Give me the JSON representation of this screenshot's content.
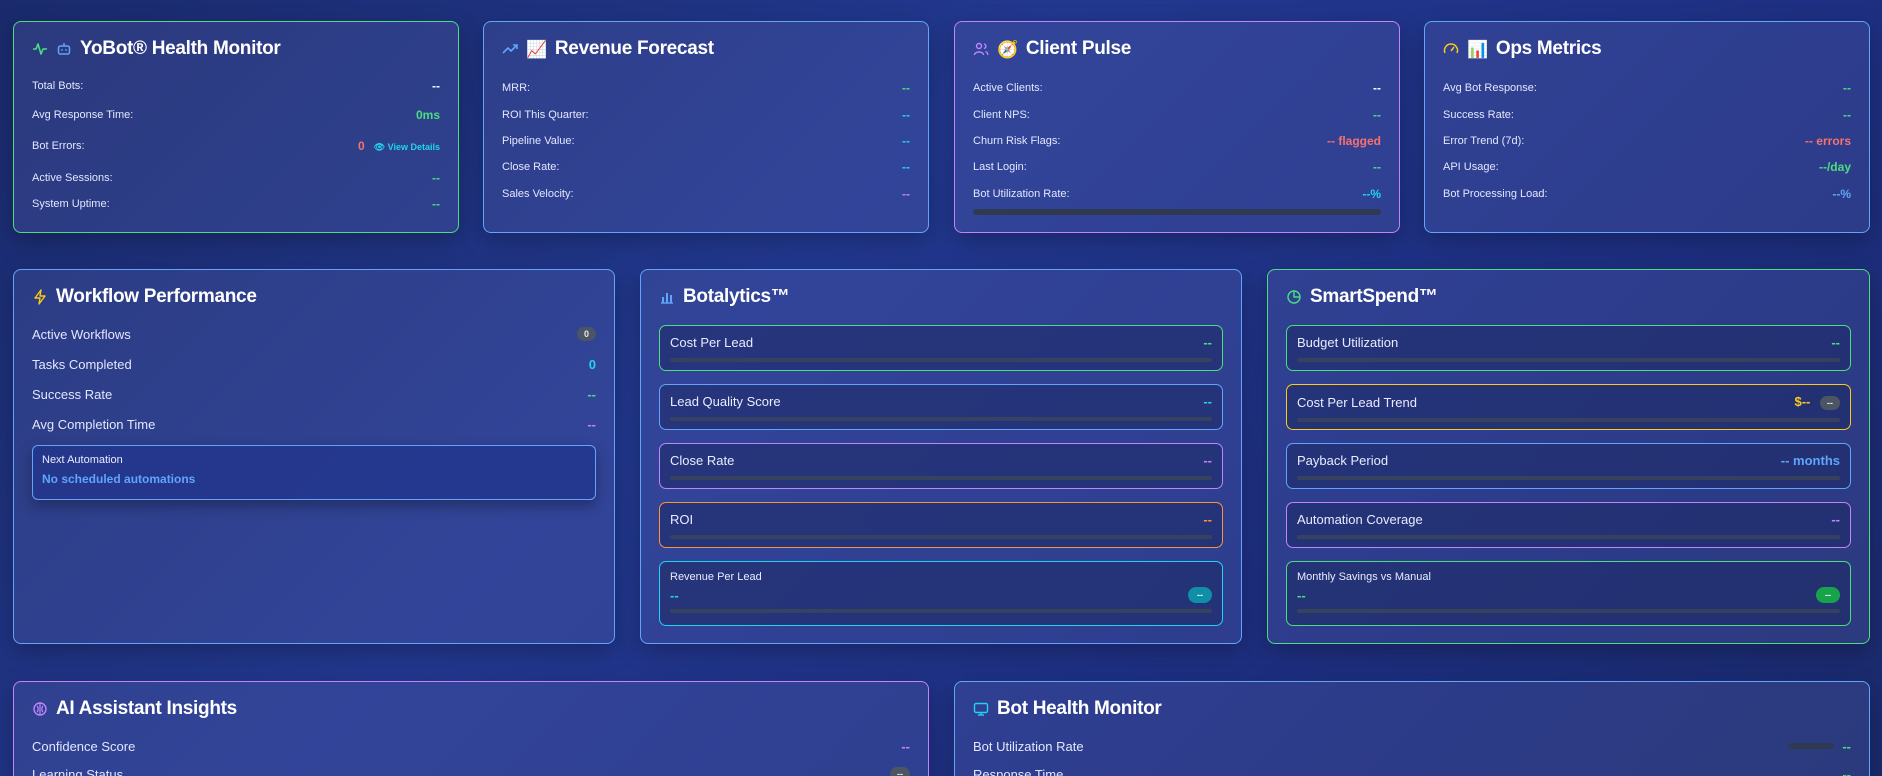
{
  "health": {
    "title": "YoBot® Health Monitor",
    "rows": [
      {
        "label": "Total Bots:",
        "value": "--"
      },
      {
        "label": "Avg Response Time:",
        "value": "0ms"
      },
      {
        "label": "Bot Errors:",
        "value": "0",
        "link": "👁 View Details"
      },
      {
        "label": "Active Sessions:",
        "value": "--"
      },
      {
        "label": "System Uptime:",
        "value": "--"
      }
    ]
  },
  "revenue": {
    "title": "Revenue Forecast",
    "emoji": "📈",
    "rows": [
      {
        "label": "MRR:",
        "value": "--"
      },
      {
        "label": "ROI This Quarter:",
        "value": "--"
      },
      {
        "label": "Pipeline Value:",
        "value": "--"
      },
      {
        "label": "Close Rate:",
        "value": "--"
      },
      {
        "label": "Sales Velocity:",
        "value": "--"
      }
    ]
  },
  "client": {
    "title": "Client Pulse",
    "emoji": "🧭",
    "rows": [
      {
        "label": "Active Clients:",
        "value": "--"
      },
      {
        "label": "Client NPS:",
        "value": "--"
      },
      {
        "label": "Churn Risk Flags:",
        "value": "-- flagged"
      },
      {
        "label": "Last Login:",
        "value": "--"
      },
      {
        "label": "Bot Utilization Rate:",
        "value": "--%"
      }
    ]
  },
  "ops": {
    "title": "Ops Metrics",
    "emoji": "📊",
    "rows": [
      {
        "label": "Avg Bot Response:",
        "value": "--"
      },
      {
        "label": "Success Rate:",
        "value": "--"
      },
      {
        "label": "Error Trend (7d):",
        "value": "-- errors"
      },
      {
        "label": "API Usage:",
        "value": "--/day"
      },
      {
        "label": "Bot Processing Load:",
        "value": "--%"
      }
    ]
  },
  "workflow": {
    "title": "Workflow Performance",
    "rows": [
      {
        "label": "Active Workflows",
        "value": "0"
      },
      {
        "label": "Tasks Completed",
        "value": "0"
      },
      {
        "label": "Success Rate",
        "value": "--"
      },
      {
        "label": "Avg Completion Time",
        "value": "--"
      }
    ],
    "next_label": "Next Automation",
    "next_value": "No scheduled automations"
  },
  "botalytics": {
    "title": "Botalytics™",
    "metrics": [
      {
        "label": "Cost Per Lead",
        "value": "--"
      },
      {
        "label": "Lead Quality Score",
        "value": "--"
      },
      {
        "label": "Close Rate",
        "value": "--"
      },
      {
        "label": "ROI",
        "value": "--"
      },
      {
        "label": "Revenue Per Lead",
        "value": "--",
        "badge": "--"
      }
    ]
  },
  "smartspend": {
    "title": "SmartSpend™",
    "metrics": [
      {
        "label": "Budget Utilization",
        "value": "--"
      },
      {
        "label": "Cost Per Lead Trend",
        "value": "$--",
        "badge": "--"
      },
      {
        "label": "Payback Period",
        "value": "-- months"
      },
      {
        "label": "Automation Coverage",
        "value": "--"
      },
      {
        "label": "Monthly Savings vs Manual",
        "value": "--",
        "badge": "--"
      }
    ]
  },
  "ai": {
    "title": "AI Assistant Insights",
    "rows": [
      {
        "label": "Confidence Score",
        "value": "--"
      },
      {
        "label": "Learning Status",
        "value": "--"
      }
    ]
  },
  "bothealth": {
    "title": "Bot Health Monitor",
    "rows": [
      {
        "label": "Bot Utilization Rate",
        "value": "--"
      },
      {
        "label": "Response Time",
        "value": "--"
      }
    ]
  }
}
